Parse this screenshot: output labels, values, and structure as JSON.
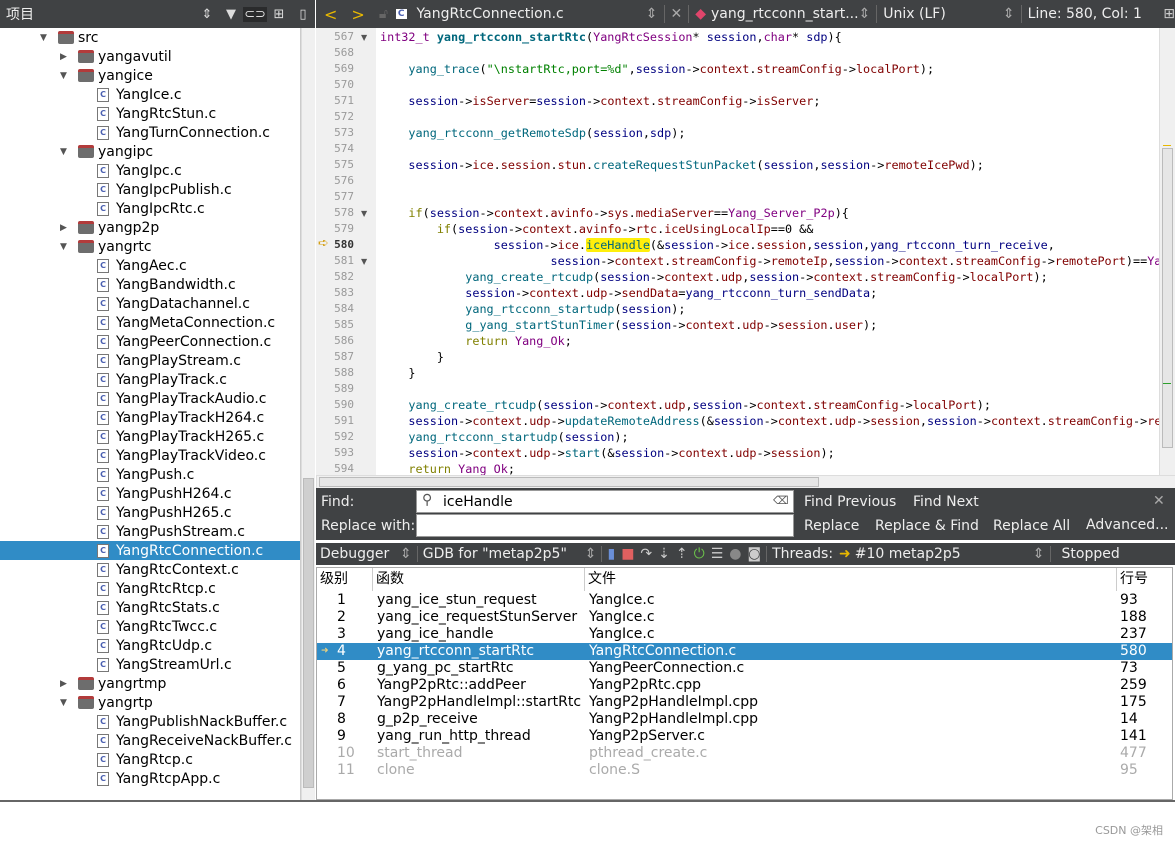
{
  "sidebar": {
    "title": "项目",
    "icons": [
      "sort-icon",
      "filter-icon",
      "link-icon",
      "split-icon",
      "close-pane-icon"
    ],
    "tree": [
      {
        "level": 1,
        "type": "folder",
        "open": true,
        "label": "src"
      },
      {
        "level": 2,
        "type": "folder",
        "open": false,
        "label": "yangavutil"
      },
      {
        "level": 2,
        "type": "folder",
        "open": true,
        "label": "yangice"
      },
      {
        "level": 3,
        "type": "file",
        "label": "YangIce.c"
      },
      {
        "level": 3,
        "type": "file",
        "label": "YangRtcStun.c"
      },
      {
        "level": 3,
        "type": "file",
        "label": "YangTurnConnection.c"
      },
      {
        "level": 2,
        "type": "folder",
        "open": true,
        "label": "yangipc"
      },
      {
        "level": 3,
        "type": "file",
        "label": "YangIpc.c"
      },
      {
        "level": 3,
        "type": "file",
        "label": "YangIpcPublish.c"
      },
      {
        "level": 3,
        "type": "file",
        "label": "YangIpcRtc.c"
      },
      {
        "level": 2,
        "type": "folder",
        "open": false,
        "label": "yangp2p"
      },
      {
        "level": 2,
        "type": "folder",
        "open": true,
        "label": "yangrtc"
      },
      {
        "level": 3,
        "type": "file",
        "label": "YangAec.c"
      },
      {
        "level": 3,
        "type": "file",
        "label": "YangBandwidth.c"
      },
      {
        "level": 3,
        "type": "file",
        "label": "YangDatachannel.c"
      },
      {
        "level": 3,
        "type": "file",
        "label": "YangMetaConnection.c"
      },
      {
        "level": 3,
        "type": "file",
        "label": "YangPeerConnection.c"
      },
      {
        "level": 3,
        "type": "file",
        "label": "YangPlayStream.c"
      },
      {
        "level": 3,
        "type": "file",
        "label": "YangPlayTrack.c"
      },
      {
        "level": 3,
        "type": "file",
        "label": "YangPlayTrackAudio.c"
      },
      {
        "level": 3,
        "type": "file",
        "label": "YangPlayTrackH264.c"
      },
      {
        "level": 3,
        "type": "file",
        "label": "YangPlayTrackH265.c"
      },
      {
        "level": 3,
        "type": "file",
        "label": "YangPlayTrackVideo.c"
      },
      {
        "level": 3,
        "type": "file",
        "label": "YangPush.c"
      },
      {
        "level": 3,
        "type": "file",
        "label": "YangPushH264.c"
      },
      {
        "level": 3,
        "type": "file",
        "label": "YangPushH265.c"
      },
      {
        "level": 3,
        "type": "file",
        "label": "YangPushStream.c"
      },
      {
        "level": 3,
        "type": "file",
        "label": "YangRtcConnection.c",
        "selected": true
      },
      {
        "level": 3,
        "type": "file",
        "label": "YangRtcContext.c"
      },
      {
        "level": 3,
        "type": "file",
        "label": "YangRtcRtcp.c"
      },
      {
        "level": 3,
        "type": "file",
        "label": "YangRtcStats.c"
      },
      {
        "level": 3,
        "type": "file",
        "label": "YangRtcTwcc.c"
      },
      {
        "level": 3,
        "type": "file",
        "label": "YangRtcUdp.c"
      },
      {
        "level": 3,
        "type": "file",
        "label": "YangStreamUrl.c"
      },
      {
        "level": 2,
        "type": "folder",
        "open": false,
        "label": "yangrtmp"
      },
      {
        "level": 2,
        "type": "folder",
        "open": true,
        "label": "yangrtp"
      },
      {
        "level": 3,
        "type": "file",
        "label": "YangPublishNackBuffer.c"
      },
      {
        "level": 3,
        "type": "file",
        "label": "YangReceiveNackBuffer.c"
      },
      {
        "level": 3,
        "type": "file",
        "label": "YangRtcp.c"
      },
      {
        "level": 3,
        "type": "file",
        "label": "YangRtcpApp.c"
      }
    ]
  },
  "editor": {
    "file_name": "YangRtcConnection.c",
    "symbol": "yang_rtcconn_start...",
    "line_ending": "Unix (LF)",
    "position": "Line: 580, Col: 1",
    "current_line": 580,
    "search_highlight": "iceHandle",
    "first_line": 567,
    "fold_lines": [
      567,
      578,
      581
    ],
    "lines": [
      "int32_t yang_rtcconn_startRtc(YangRtcSession* session,char* sdp){",
      "",
      "    yang_trace(\"\\nstartRtc,port=%d\",session->context.streamConfig->localPort);",
      "",
      "    session->isServer=session->context.streamConfig->isServer;",
      "",
      "    yang_rtcconn_getRemoteSdp(session,sdp);",
      "",
      "    session->ice.session.stun.createRequestStunPacket(session,session->remoteIcePwd);",
      "",
      "",
      "    if(session->context.avinfo->sys.mediaServer==Yang_Server_P2p){",
      "        if(session->context.avinfo->rtc.iceUsingLocalIp==0 &&",
      "                session->ice.iceHandle(&session->ice.session,session,yang_rtcconn_turn_receive,",
      "                        session->context.streamConfig->remoteIp,session->context.streamConfig->remotePort)==Yang_Ok){",
      "            yang_create_rtcudp(session->context.udp,session->context.streamConfig->localPort);",
      "            session->context.udp->sendData=yang_rtcconn_turn_sendData;",
      "            yang_rtcconn_startudp(session);",
      "            g_yang_startStunTimer(session->context.udp->session.user);",
      "            return Yang_Ok;",
      "        }",
      "    }",
      "",
      "    yang_create_rtcudp(session->context.udp,session->context.streamConfig->localPort);",
      "    session->context.udp->updateRemoteAddress(&session->context.udp->session,session->context.streamConfig->remoteIp);",
      "    yang_rtcconn_startudp(session);",
      "    session->context.udp->start(&session->context.udp->session);",
      "    return Yang_Ok;"
    ]
  },
  "find": {
    "find_label": "Find:",
    "replace_label": "Replace with:",
    "find_value": "iceHandle",
    "replace_value": "",
    "find_previous": "Find Previous",
    "find_next": "Find Next",
    "replace": "Replace",
    "replace_find": "Replace & Find",
    "replace_all": "Replace All",
    "advanced": "Advanced..."
  },
  "debugger": {
    "mode": "Debugger",
    "engine": "GDB for \"metap2p5\"",
    "threads_label": "Threads:",
    "thread": "#10 metap2p5",
    "status": "Stopped"
  },
  "stack": {
    "columns": [
      "级别",
      "函数",
      "文件",
      "行号"
    ],
    "rows": [
      {
        "level": "1",
        "function": "yang_ice_stun_request",
        "file": "YangIce.c",
        "line": "93"
      },
      {
        "level": "2",
        "function": "yang_ice_requestStunServer",
        "file": "YangIce.c",
        "line": "188"
      },
      {
        "level": "3",
        "function": "yang_ice_handle",
        "file": "YangIce.c",
        "line": "237"
      },
      {
        "level": "4",
        "function": "yang_rtcconn_startRtc",
        "file": "YangRtcConnection.c",
        "line": "580",
        "current": true
      },
      {
        "level": "5",
        "function": "g_yang_pc_startRtc",
        "file": "YangPeerConnection.c",
        "line": "73"
      },
      {
        "level": "6",
        "function": "YangP2pRtc::addPeer",
        "file": "YangP2pRtc.cpp",
        "line": "259"
      },
      {
        "level": "7",
        "function": "YangP2pHandleImpl::startRtc",
        "file": "YangP2pHandleImpl.cpp",
        "line": "175"
      },
      {
        "level": "8",
        "function": "g_p2p_receive",
        "file": "YangP2pHandleImpl.cpp",
        "line": "14"
      },
      {
        "level": "9",
        "function": "yang_run_http_thread",
        "file": "YangP2pServer.c",
        "line": "141"
      },
      {
        "level": "10",
        "function": "start_thread",
        "file": "pthread_create.c",
        "line": "477",
        "dim": true
      },
      {
        "level": "11",
        "function": "clone",
        "file": "clone.S",
        "line": "95",
        "dim": true
      }
    ]
  },
  "watermark": "CSDN @架相",
  "colors": {
    "selection": "#308cc6",
    "toolbar": "#404244",
    "search_highlight": "#ffef0b",
    "keyword": "#808000",
    "function": "#00677c",
    "member": "#800000",
    "string": "#008000"
  }
}
